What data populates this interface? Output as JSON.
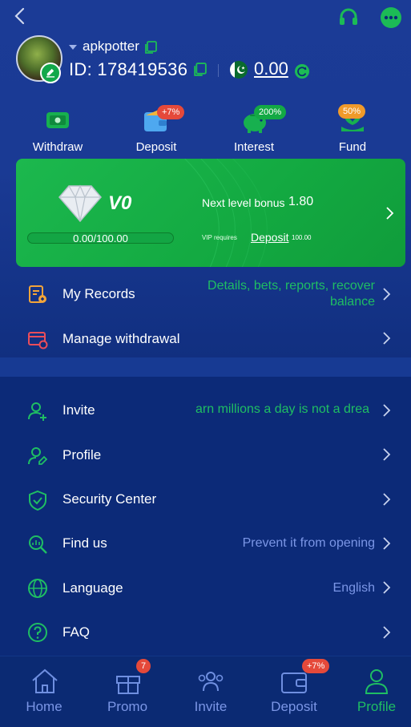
{
  "header": {
    "username": "apkpotter",
    "uid_label": "ID: 178419536",
    "balance": "0.00"
  },
  "quick_actions": [
    {
      "label": "Withdraw",
      "icon": "withdraw-icon",
      "badge": ""
    },
    {
      "label": "Deposit",
      "icon": "wallet-icon",
      "badge": "+7%"
    },
    {
      "label": "Interest",
      "icon": "piggy-bank-icon",
      "badge": "200%"
    },
    {
      "label": "Fund",
      "icon": "fund-icon",
      "badge": "50%"
    }
  ],
  "vip": {
    "level": "V0",
    "progress_text": "0.00/100.00",
    "progress_fraction": 0,
    "next_level_label": "Next level bonus",
    "next_level_value": "1.80",
    "requires_label": "VIP requires",
    "deposit_link": "Deposit",
    "requires_amount": "100.00"
  },
  "menu_group_1": [
    {
      "label": "My Records",
      "icon": "records-icon",
      "right_text_1": "Details, bets, reports, recover",
      "right_text_2": "balance"
    },
    {
      "label": "Manage withdrawal",
      "icon": "card-settings-icon",
      "right_text_1": "",
      "right_text_2": ""
    }
  ],
  "menu_group_2": [
    {
      "label": "Invite",
      "icon": "invite-user-icon",
      "right_text": "arn millions a day is not a drea"
    },
    {
      "label": "Profile",
      "icon": "profile-edit-icon",
      "right_text": ""
    },
    {
      "label": "Security Center",
      "icon": "shield-check-icon",
      "right_text": ""
    },
    {
      "label": "Find us",
      "icon": "find-us-icon",
      "right_text": "Prevent it from opening"
    },
    {
      "label": "Language",
      "icon": "globe-icon",
      "right_text": "English"
    },
    {
      "label": "FAQ",
      "icon": "help-icon",
      "right_text": ""
    }
  ],
  "bottom_nav": [
    {
      "label": "Home",
      "icon": "home-icon",
      "badge": "",
      "active": false
    },
    {
      "label": "Promo",
      "icon": "gift-icon",
      "badge": "7",
      "active": false
    },
    {
      "label": "Invite",
      "icon": "people-icon",
      "badge": "",
      "active": false
    },
    {
      "label": "Deposit",
      "icon": "wallet-icon",
      "badge": "+7%",
      "active": false
    },
    {
      "label": "Profile",
      "icon": "person-icon",
      "badge": "",
      "active": true
    }
  ],
  "colors": {
    "accent_green": "#13a944",
    "text_green": "#1fbe63",
    "text_blue": "#7b96e6",
    "badge_red": "#e5493a",
    "badge_orange": "#f09a2a",
    "background_navy": "#0c2a78"
  }
}
